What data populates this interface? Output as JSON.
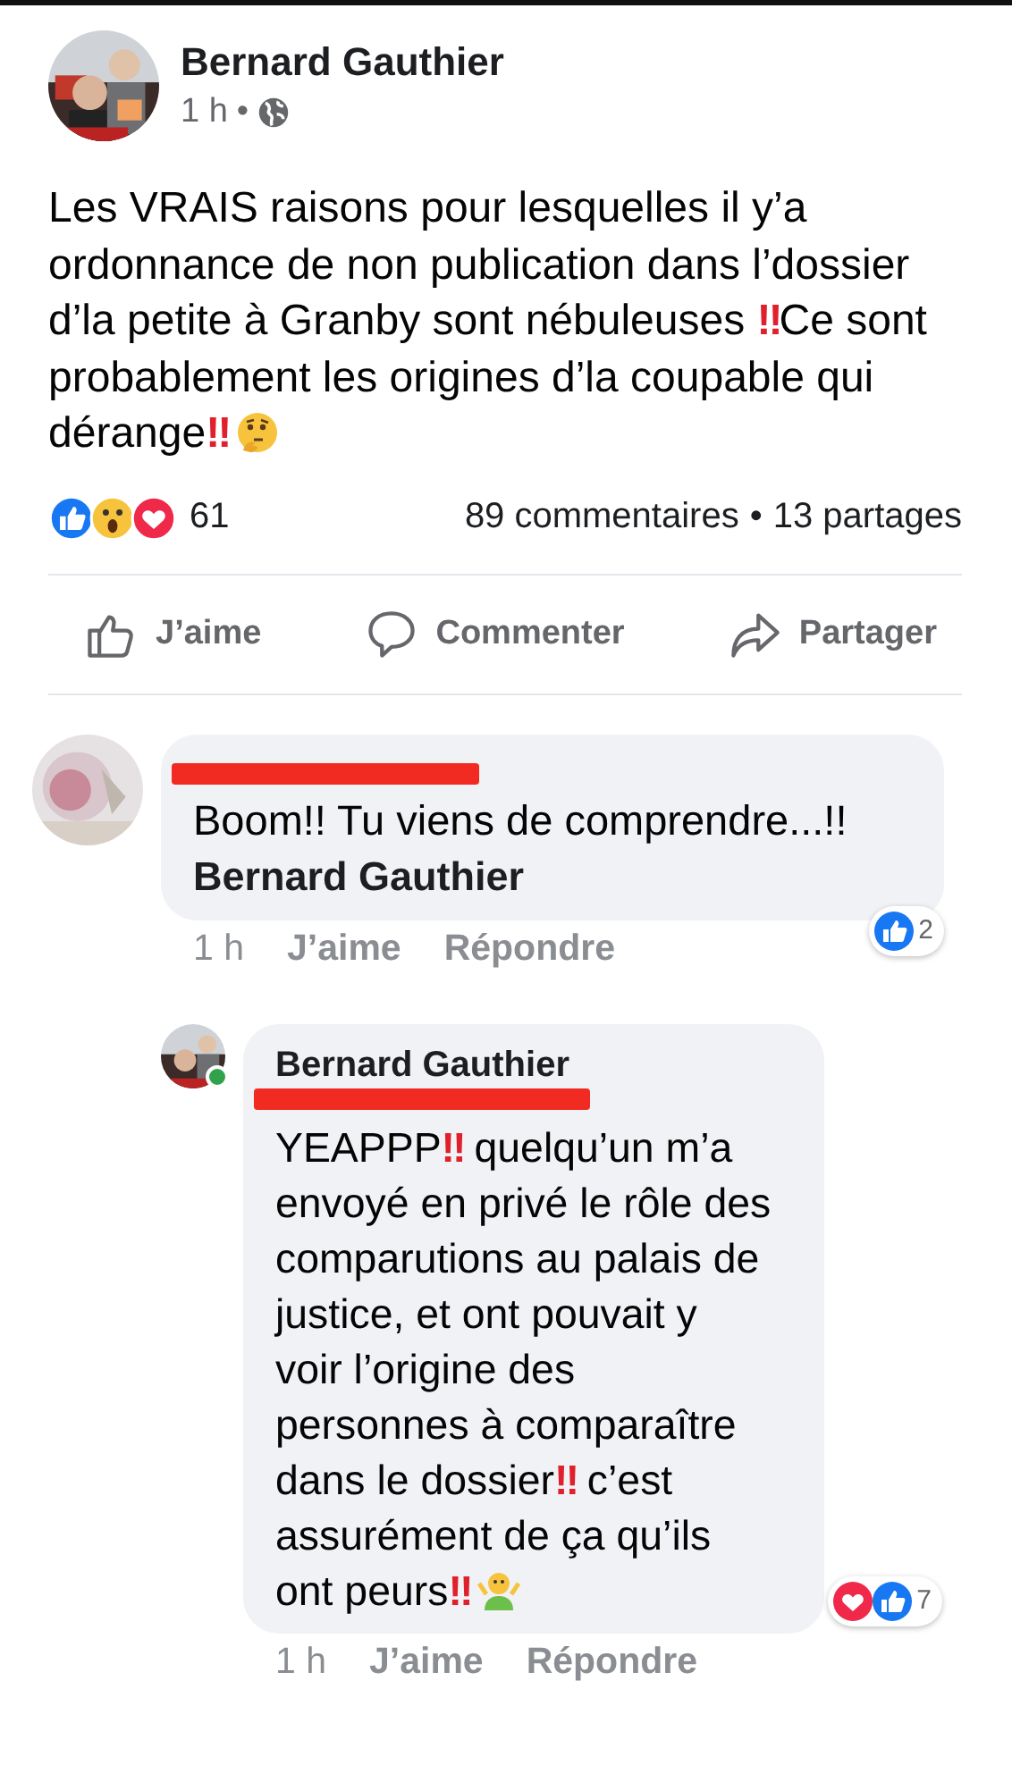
{
  "post": {
    "author": "Bernard Gauthier",
    "time": "1 h",
    "separator": "•",
    "body": "Les VRAIS raisons pour lesquelles il y’a ordonnance de non publication dans l’dossier d’la petite à Granby sont nébuleuses ‼Ce sont probablement les origines d’la coupable qui dérange‼",
    "reaction_count": "61",
    "comments": "89 commentaires",
    "dot": "•",
    "shares": "13 partages",
    "actions": [
      {
        "kind": "like",
        "label": "J’aime"
      },
      {
        "kind": "comment",
        "label": "Commenter"
      },
      {
        "kind": "share",
        "label": "Partager"
      }
    ]
  },
  "comments": [
    {
      "name_redacted": true,
      "text": "Boom!! Tu viens de comprendre...!!",
      "tag": "Bernard Gauthier",
      "time": "1 h",
      "like": "J’aime",
      "reply": "Répondre",
      "reactions": [
        {
          "kind": "like"
        }
      ],
      "reaction_count": "2",
      "replies": [
        {
          "author": "Bernard Gauthier",
          "online": true,
          "name_redacted": true,
          "text": "YEAPPP‼ quelqu’un m’a envoyé en privé le rôle des comparutions au palais de justice, et ont pouvait y voir l’origine des personnes à comparaître dans le dossier‼ c’est assurément de ça qu’ils ont peurs‼",
          "time": "1 h",
          "like": "J’aime",
          "reply": "Répondre",
          "reactions": [
            {
              "kind": "love"
            },
            {
              "kind": "like"
            }
          ],
          "reaction_count": "7"
        }
      ]
    }
  ]
}
